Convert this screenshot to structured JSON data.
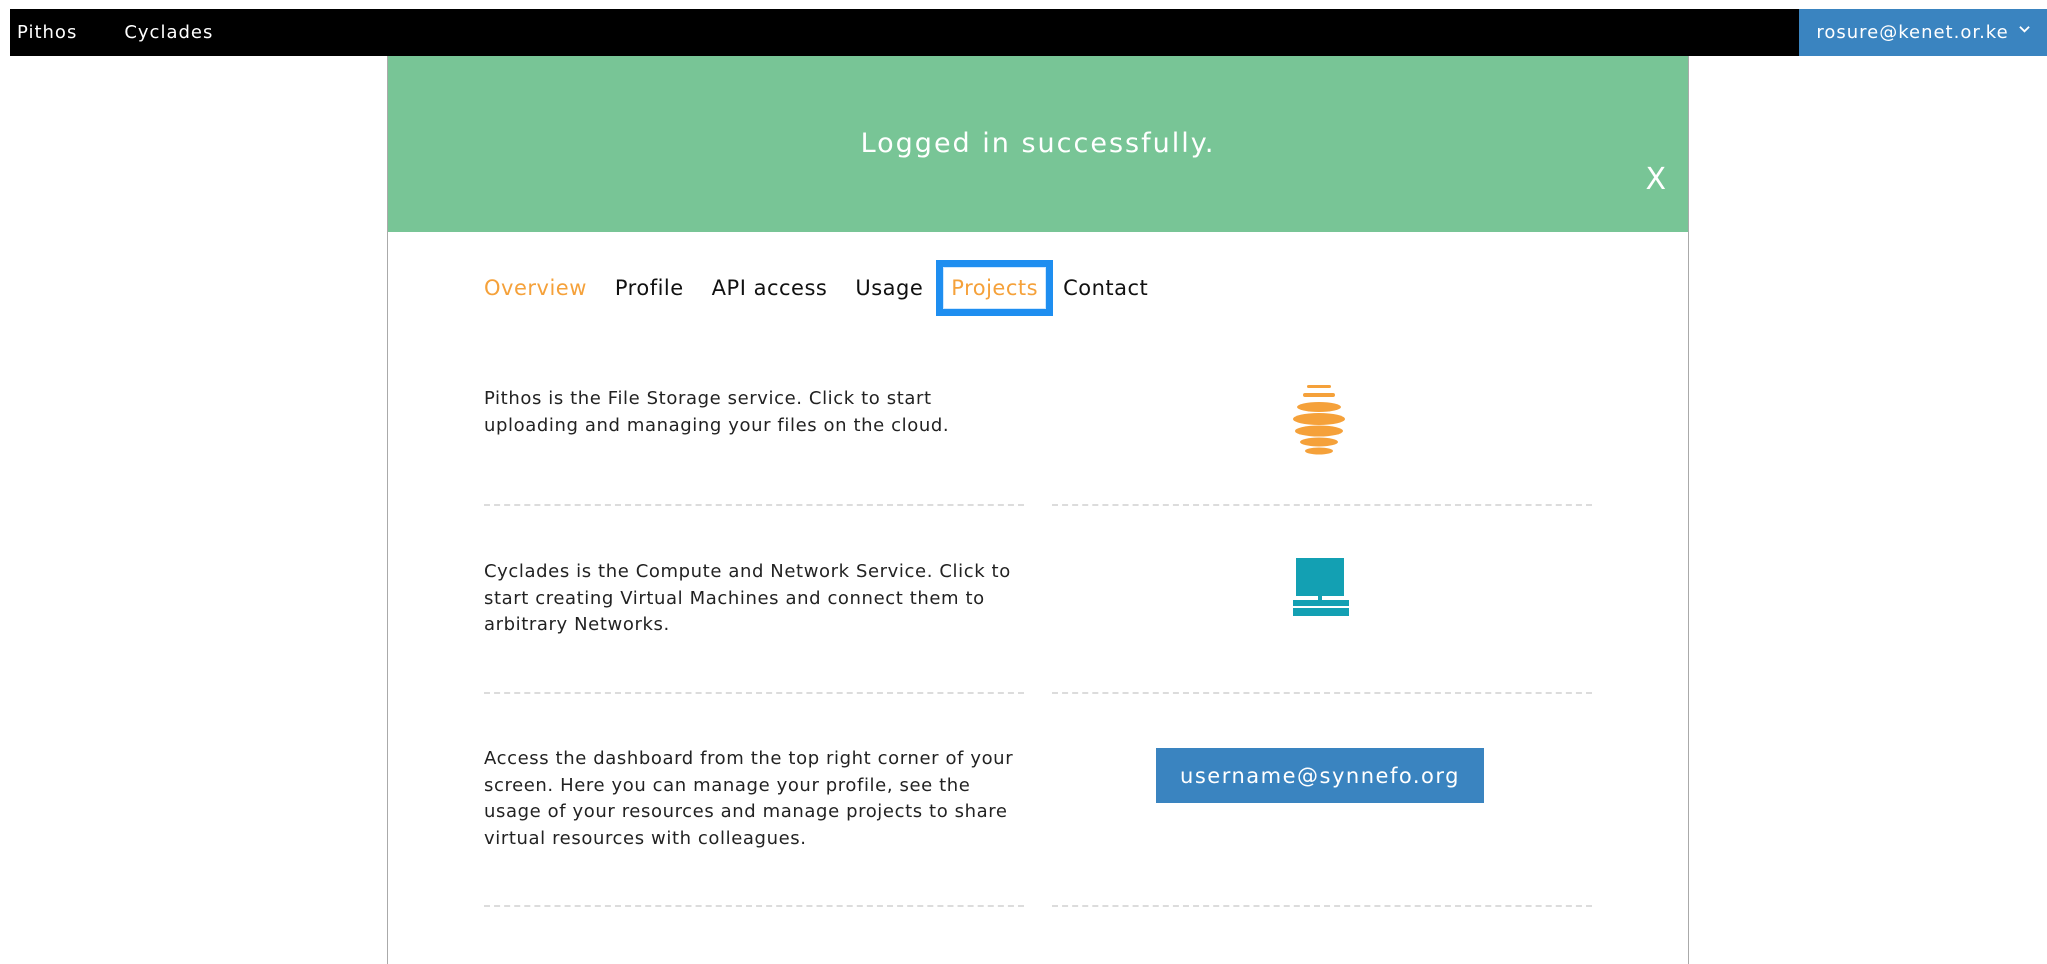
{
  "topbar": {
    "nav": [
      {
        "label": "Pithos"
      },
      {
        "label": "Cyclades"
      }
    ],
    "user_email": "rosure@kenet.or.ke"
  },
  "banner": {
    "message": "Logged in successfully.",
    "close_label": "X"
  },
  "tabs": [
    {
      "label": "Overview"
    },
    {
      "label": "Profile"
    },
    {
      "label": "API access"
    },
    {
      "label": "Usage"
    },
    {
      "label": "Projects"
    },
    {
      "label": "Contact"
    }
  ],
  "services": {
    "pithos_text": "Pithos is the File Storage service. Click to start uploading and managing your files on the cloud.",
    "cyclades_text": "Cyclades is the Compute and Network Service. Click to start creating Virtual Machines and connect them to arbitrary Networks.",
    "dashboard_text": "Access the dashboard from the top right corner of your screen. Here you can manage your profile, see the usage of your resources and manage projects to share virtual resources with colleagues.",
    "dashboard_button": "username@synnefo.org"
  },
  "colors": {
    "banner": "#78c596",
    "accent_orange": "#f5a13a",
    "accent_blue": "#3a84c0",
    "cyclades_teal": "#13a0b3",
    "highlight_box": "#1e8ef0"
  },
  "icons": [
    "chevron-down-icon",
    "pithos-logo-icon",
    "cyclades-computer-icon"
  ]
}
